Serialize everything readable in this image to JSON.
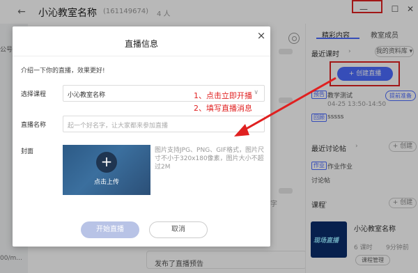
{
  "topbar": {
    "back_glyph": "←",
    "room_title": "小沁教室名称",
    "room_id": "(161149674)",
    "member_count": "4 人",
    "min_glyph": "—",
    "max_glyph": "☐",
    "close_glyph": "✕"
  },
  "left_strip": {
    "label": "公号",
    "bottom_text": "00/m..."
  },
  "chat": {
    "bg_text": "字",
    "bottom_bubble": "发布了直播预告"
  },
  "right_panel": {
    "tabs": [
      "精彩内容",
      "教室成员"
    ],
    "recent_course": {
      "title": "最近课时",
      "chevron": "›",
      "library_select": "我的资料库 ▾",
      "create_live_label": "+ 创建直播",
      "item1_badge": "预告",
      "item1_title": "教学测试",
      "item1_time": "04-25 13:50-14:50",
      "item1_prepare": "提前准备",
      "item2_badge": "回顾",
      "item2_title": "sssss"
    },
    "forum": {
      "title": "最近讨论帖",
      "chevron": "›",
      "create_label": "+ 创建",
      "item_badge": "作业",
      "item_title": "作业作业",
      "item_sub": "讨论帖"
    },
    "courses": {
      "title": "课程",
      "chevron": "›",
      "create_label": "+ 创建",
      "thumb_text": "现场直播",
      "name": "小沁教室名称",
      "lessons": "6 课时",
      "time_ago": "9分钟前",
      "small_btn": "课程管理"
    }
  },
  "modal": {
    "title": "直播信息",
    "close_glyph": "×",
    "intro": "介绍一下你的直播，效果更好!",
    "course_label": "选择课程",
    "course_value": "小沁教室名称",
    "course_arrow": "∨",
    "name_label": "直播名称",
    "name_placeholder": "起一个好名字，让大家都来参加直播",
    "cover_label": "封面",
    "cover_plus": "+",
    "cover_upload": "点击上传",
    "cover_hint": "图片支持JPG、PNG、GIF格式，图片尺寸不小于320x180像素，图片大小不超过2M",
    "start_button": "开始直播",
    "cancel_button": "取消"
  },
  "annotations": {
    "step1": "1、点击立即开播",
    "step2": "2、填写直播消息",
    "color": "#e02020"
  },
  "colors": {
    "accent": "#4b6bff",
    "annotation_red": "#e02020",
    "start_disabled": "#b8c3e6"
  }
}
